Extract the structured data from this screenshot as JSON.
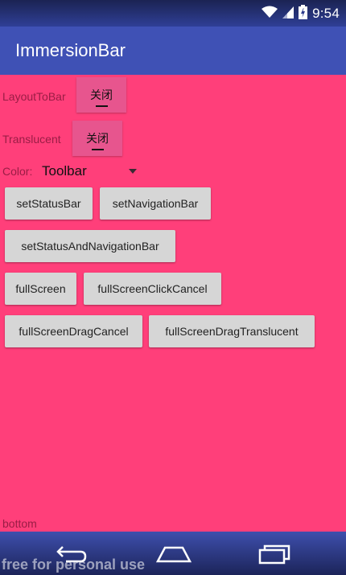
{
  "status_bar": {
    "time": "9:54",
    "icons": [
      "wifi-icon",
      "signal-icon",
      "battery-charging-icon"
    ]
  },
  "app_bar": {
    "title": "ImmersionBar"
  },
  "controls": {
    "layout_to_bar": {
      "label": "LayoutToBar",
      "button": "关闭"
    },
    "translucent": {
      "label": "Translucent",
      "button": "关闭"
    },
    "color": {
      "label": "Color:",
      "selected": "Toolbar"
    }
  },
  "buttons": {
    "set_status_bar": "setStatusBar",
    "set_navigation_bar": "setNavigationBar",
    "set_status_and_navigation_bar": "setStatusAndNavigationBar",
    "full_screen": "fullScreen",
    "full_screen_click_cancel": "fullScreenClickCancel",
    "full_screen_drag_cancel": "fullScreenDragCancel",
    "full_screen_drag_translucent": "fullScreenDragTranslucent"
  },
  "bottom_label": "bottom",
  "nav_bar": {
    "icons": [
      "back-icon",
      "home-icon",
      "recents-icon"
    ]
  },
  "watermark": "free for personal use",
  "colors": {
    "status_bar": "#27347a",
    "app_bar": "#3f51b5",
    "content_bg": "#ff3f7a",
    "button_bg": "#d6d6d6"
  }
}
